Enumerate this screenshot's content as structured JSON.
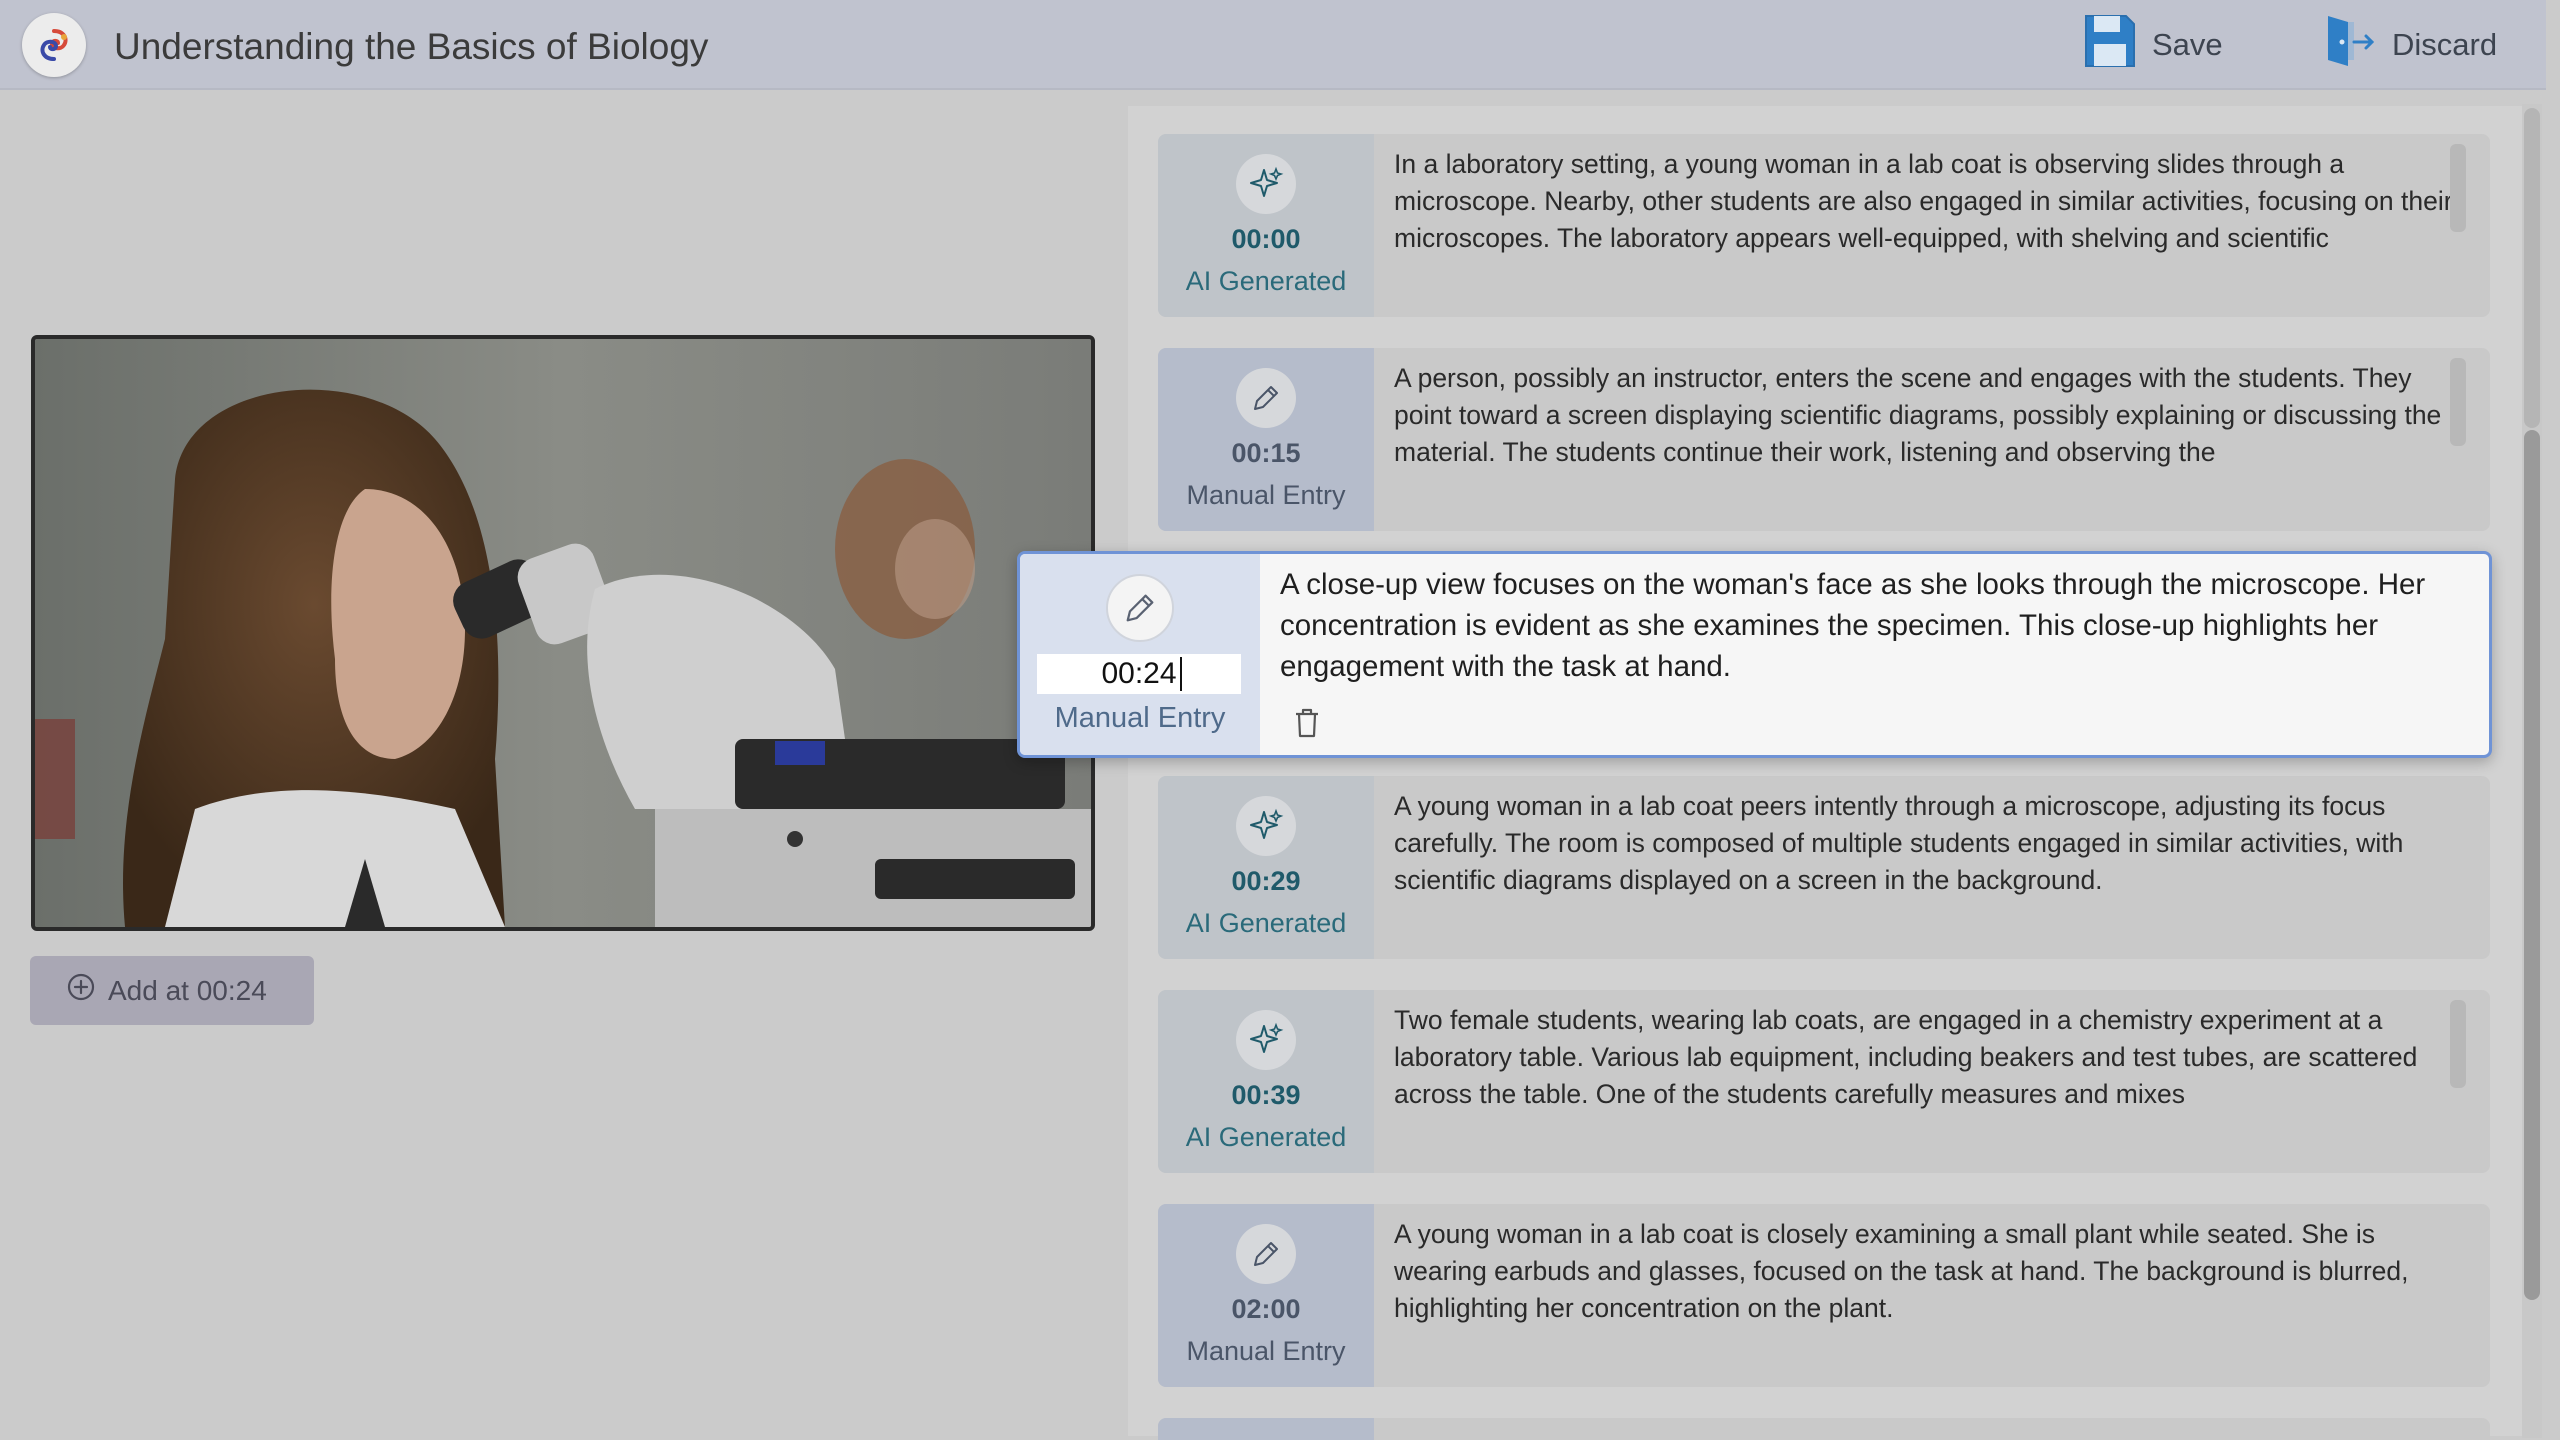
{
  "header": {
    "title": "Understanding the Basics of Biology",
    "save_label": "Save",
    "discard_label": "Discard",
    "logo_icon": "swirl-logo-icon"
  },
  "left": {
    "add_label": "Add at 00:24"
  },
  "entries": [
    {
      "time": "00:00",
      "kind": "AI Generated",
      "icon": "sparkle-icon",
      "text": "In a laboratory setting, a young woman in a lab coat is observing slides through a microscope. Nearby, other students are also engaged in similar activities, focusing on their microscopes. The laboratory appears well-equipped, with shelving and scientific"
    },
    {
      "time": "00:15",
      "kind": "Manual Entry",
      "icon": "pencil-icon",
      "text": "A person, possibly an instructor, enters the scene and engages with the students. They point toward a screen displaying scientific diagrams, possibly explaining or discussing the material. The students continue their work, listening and observing the"
    },
    {
      "time": "00:24",
      "kind": "Manual Entry",
      "icon": "pencil-icon",
      "active": true,
      "text": "A close-up view focuses on the woman's face as she looks through the microscope. Her concentration is evident as she examines the specimen. This close-up highlights her engagement with the task at hand."
    },
    {
      "time": "00:29",
      "kind": "AI Generated",
      "icon": "sparkle-icon",
      "text": "A young woman in a lab coat peers intently through a microscope, adjusting its focus carefully. The room is composed of multiple students engaged in similar activities, with scientific diagrams displayed on a screen in the background."
    },
    {
      "time": "00:39",
      "kind": "AI Generated",
      "icon": "sparkle-icon",
      "text": "Two female students, wearing lab coats, are engaged in a chemistry experiment at a laboratory table. Various lab equipment, including beakers and test tubes, are scattered across the table. One of the students carefully measures and mixes"
    },
    {
      "time": "02:00",
      "kind": "Manual Entry",
      "icon": "pencil-icon",
      "text": "A young woman in a lab coat is closely examining a small plant while seated. She is wearing earbuds and glasses, focused on the task at hand. The background is blurred, highlighting her concentration on the plant."
    }
  ],
  "colors": {
    "ai_accent": "#1f5a6a",
    "manual_accent": "#4a5568",
    "active_border": "#6f93d6"
  }
}
